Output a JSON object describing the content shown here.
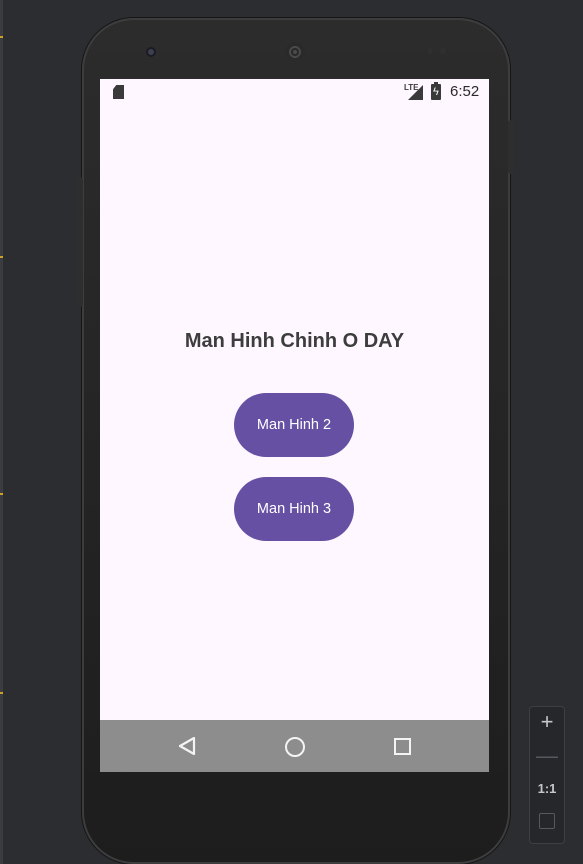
{
  "status_bar": {
    "network_label": "LTE",
    "time": "6:52"
  },
  "main": {
    "title": "Man Hinh Chinh O DAY",
    "buttons": [
      {
        "label": "Man Hinh 2"
      },
      {
        "label": "Man Hinh 3"
      }
    ]
  },
  "zoom_controls": {
    "zoom_in": "+",
    "zoom_out": "—",
    "actual_size": "1:1"
  },
  "colors": {
    "button": "#6650a4",
    "screen_background": "#fef7ff",
    "nav_bar": "#8e8d8e"
  },
  "icons": {
    "status_left": "sd-card-icon",
    "signal": "signal-icon",
    "battery": "battery-charging-icon",
    "nav": [
      "back-icon",
      "home-icon",
      "recent-apps-icon"
    ],
    "zoom_fit": "fit-screen-icon"
  }
}
